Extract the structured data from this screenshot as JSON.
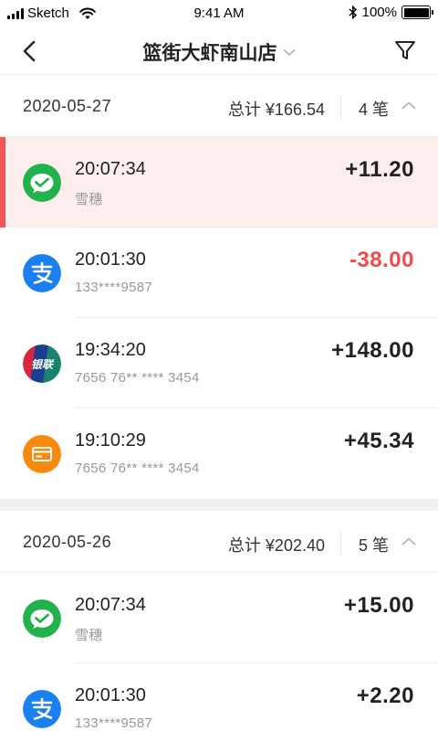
{
  "status_bar": {
    "carrier": "Sketch",
    "time": "9:41 AM",
    "battery": "100%",
    "battery_level": 1.0
  },
  "nav": {
    "title": "篮街大虾南山店",
    "icons": {
      "back": "chevron-left-icon",
      "dropdown": "chevron-down-icon",
      "filter": "filter-icon"
    }
  },
  "groups": [
    {
      "date": "2020-05-27",
      "total": "总计 ¥166.54",
      "count": "4 笔",
      "expanded": true,
      "transactions": [
        {
          "time": "20:07:34",
          "sub": "雪穗",
          "amount": "+11.20",
          "method": "wechat-pay",
          "active": true
        },
        {
          "time": "20:01:30",
          "sub": "133****9587",
          "amount": "-38.00",
          "method": "alipay",
          "negative": true
        },
        {
          "time": "19:34:20",
          "sub": "7656 76** **** 3454",
          "amount": "+148.00",
          "method": "unionpay"
        },
        {
          "time": "19:10:29",
          "sub": "7656 76** **** 3454",
          "amount": "+45.34",
          "method": "card"
        }
      ]
    },
    {
      "date": "2020-05-26",
      "total": "总计 ¥202.40",
      "count": "5 笔",
      "expanded": true,
      "transactions": [
        {
          "time": "20:07:34",
          "sub": "雪穗",
          "amount": "+15.00",
          "method": "wechat-pay"
        },
        {
          "time": "20:01:30",
          "sub": "133****9587",
          "amount": "+2.20",
          "method": "alipay"
        }
      ]
    }
  ],
  "colors": {
    "wechat": "#22b24c",
    "alipay": "#1a7ff0",
    "card": "#f7890f",
    "negative": "#f04b4b",
    "active_row": "#fdeeee",
    "active_bar": "#f25757"
  },
  "unionpay_logo_text": "银联"
}
